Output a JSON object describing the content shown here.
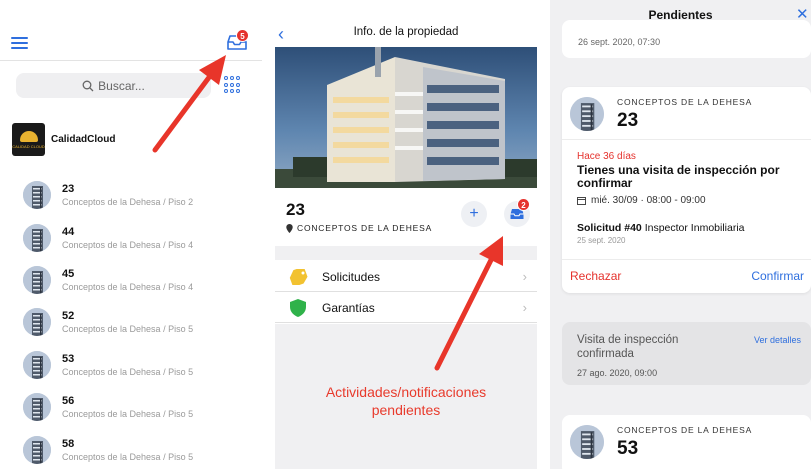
{
  "panel1": {
    "inbox_badge": "5",
    "search_placeholder": "Buscar...",
    "org_name": "CalidadCloud",
    "org_logo_text": "CALIDAD CLOUD",
    "properties": [
      {
        "num": "23",
        "sub": "Conceptos de la Dehesa / Piso 2"
      },
      {
        "num": "44",
        "sub": "Conceptos de la Dehesa / Piso 4"
      },
      {
        "num": "45",
        "sub": "Conceptos de la Dehesa / Piso 4"
      },
      {
        "num": "52",
        "sub": "Conceptos de la Dehesa / Piso 5"
      },
      {
        "num": "53",
        "sub": "Conceptos de la Dehesa / Piso 5"
      },
      {
        "num": "56",
        "sub": "Conceptos de la Dehesa / Piso 5"
      },
      {
        "num": "58",
        "sub": "Conceptos de la Dehesa / Piso 5"
      }
    ]
  },
  "panel2": {
    "title": "Info. de la propiedad",
    "property_num": "23",
    "property_project": "CONCEPTOS DE LA DEHESA",
    "inbox_badge": "2",
    "menu": [
      {
        "label": "Solicitudes"
      },
      {
        "label": "Garantías"
      }
    ],
    "annotation": "Actividades/notificaciones pendientes"
  },
  "panel3": {
    "title": "Pendientes",
    "stub_date": "26 sept. 2020, 07:30",
    "card": {
      "project": "CONCEPTOS DE LA DEHESA",
      "num": "23",
      "when": "Hace 36 días",
      "title": "Tienes una visita de inspección por confirmar",
      "date": "mié. 30/09  ·  08:00 - 09:00",
      "solicitud_id": "Solicitud #40",
      "solicitud_desc": "Inspector Inmobiliaria",
      "solicitud_date": "25 sept. 2020",
      "reject_label": "Rechazar",
      "confirm_label": "Confirmar"
    },
    "card2": {
      "title": "Visita de inspección confirmada",
      "date": "27 ago. 2020, 09:00",
      "link": "Ver detalles"
    },
    "card3": {
      "project": "CONCEPTOS DE LA DEHESA",
      "num": "53"
    }
  },
  "colors": {
    "accent": "#2f6fde",
    "alert": "#e5322d",
    "annotation": "#e83a2c"
  }
}
